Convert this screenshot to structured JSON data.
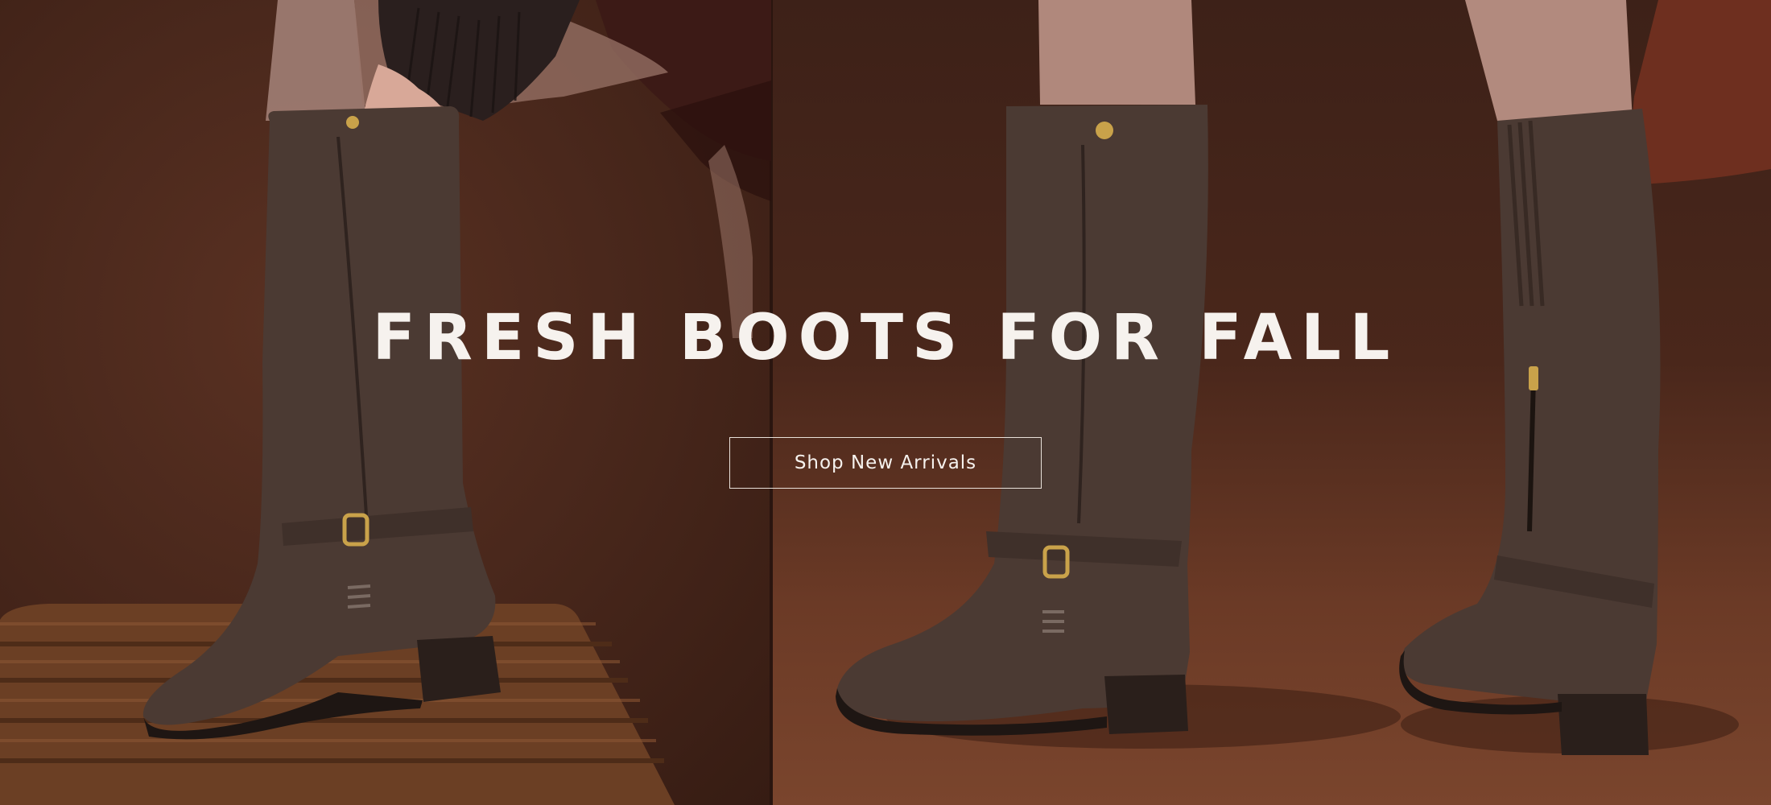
{
  "hero": {
    "headline": "FRESH BOOTS FOR FALL",
    "cta_label": "Shop New Arrivals"
  },
  "colors": {
    "headline_text": "#f6f2ee",
    "cta_border": "#e9e1da",
    "background_left": "#4a281c",
    "background_right": "#6b3a26",
    "boot_suede": "#4b3a33",
    "hardware_gold": "#c9a24a"
  }
}
